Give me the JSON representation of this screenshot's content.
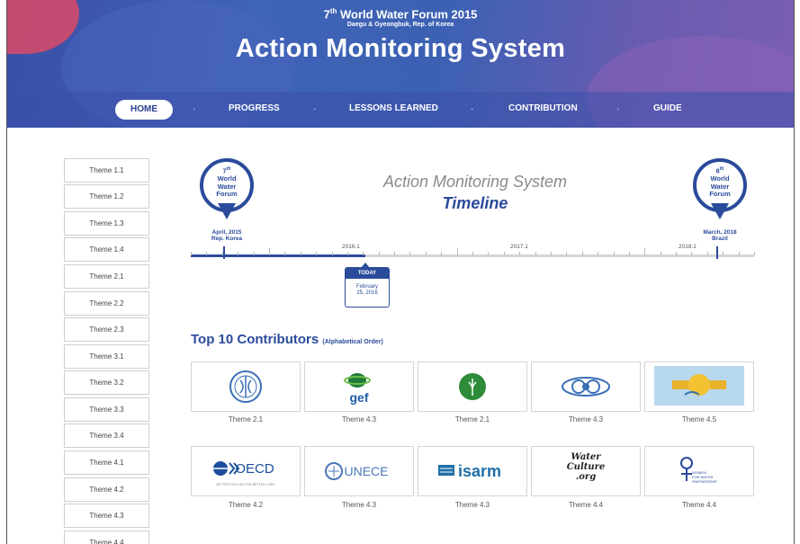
{
  "header": {
    "forum_title_prefix": "7",
    "forum_title_sup": "th",
    "forum_title_rest": " World Water Forum 2015",
    "forum_subtitle": "Daegu & Gyeongbuk, Rep. of Korea",
    "title": "Action Monitoring System"
  },
  "nav": {
    "items": [
      "HOME",
      "PROGRESS",
      "LESSONS LEARNED",
      "CONTRIBUTION",
      "GUIDE"
    ],
    "separator": "·",
    "active": "HOME"
  },
  "sidebar": {
    "items": [
      "Theme 1.1",
      "Theme 1.2",
      "Theme 1.3",
      "Theme 1.4",
      "Theme 2.1",
      "Theme 2.2",
      "Theme 2.3",
      "Theme 3.1",
      "Theme 3.2",
      "Theme 3.3",
      "Theme 3.4",
      "Theme 4.1",
      "Theme 4.2",
      "Theme 4.3",
      "Theme 4.4"
    ]
  },
  "timeline": {
    "heading_line1": "Action Monitoring System",
    "heading_line2": "Timeline",
    "start_pin": {
      "line1_num": "7",
      "line1_sup": "th",
      "line2": "World",
      "line3": "Water",
      "line4": "Forum",
      "date": "April, 2015",
      "place": "Rep. Korea"
    },
    "end_pin": {
      "line1_num": "8",
      "line1_sup": "th",
      "line2": "World",
      "line3": "Water",
      "line4": "Forum",
      "date": "March, 2018",
      "place": "Brazil"
    },
    "years": [
      "2016.1",
      "2017.1",
      "2018.1"
    ],
    "today_label": "TODAY",
    "today_date_line1": "February",
    "today_date_line2": "25, 2016",
    "progress_fraction": 0.31
  },
  "contributors": {
    "title": "Top 10 Contributors",
    "title_note": "(Alphabetical Order)",
    "logos": [
      {
        "name": "FAO",
        "label": "Theme 2.1",
        "icon": "fao-logo"
      },
      {
        "name": "gef",
        "label": "Theme 4.3",
        "icon": "gef-logo"
      },
      {
        "name": "IFAD",
        "label": "Theme 2.1",
        "icon": "wheat-logo"
      },
      {
        "name": "INBO",
        "label": "Theme 4.3",
        "icon": "globe-logo"
      },
      {
        "name": "Partner",
        "label": "Theme 4.5",
        "icon": "partner-logo"
      },
      {
        "name": "OECD",
        "label": "Theme 4.2",
        "icon": "oecd-logo",
        "subtext": "BETTER POLICIES FOR BETTER LIVES"
      },
      {
        "name": "UNECE",
        "label": "Theme 4.3",
        "icon": "unece-logo"
      },
      {
        "name": "isarm",
        "label": "Theme 4.3",
        "icon": "isarm-logo"
      },
      {
        "name": "Water Culture .org",
        "label": "Theme 4.4",
        "icon": "waterculture-logo",
        "lines": [
          "Water",
          "Culture",
          ".org"
        ]
      },
      {
        "name": "Women for Water Partnership",
        "label": "Theme 4.4",
        "icon": "wfwp-logo",
        "lines": [
          "WOMEN",
          "FOR WATER",
          "PARTNERSHIP"
        ]
      }
    ]
  },
  "colors": {
    "brand": "#2a4b9b",
    "header_bg": "#3f63b6",
    "accent_pink": "#d24a6a"
  }
}
